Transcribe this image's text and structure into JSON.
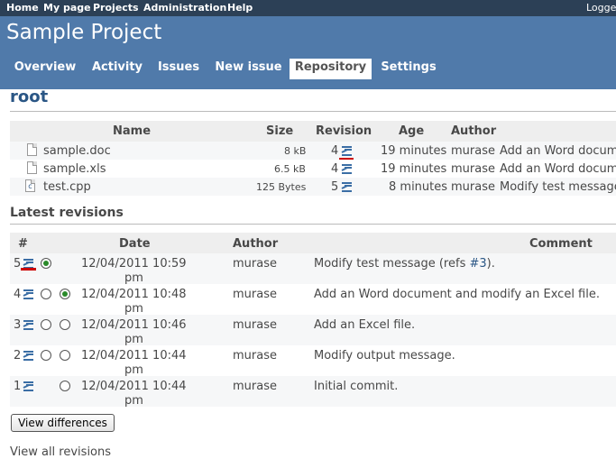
{
  "top_menu": {
    "home": "Home",
    "my_page": "My page",
    "projects": "Projects",
    "administration": "Administration",
    "help": "Help",
    "logged": "Logge"
  },
  "header": {
    "title": "Sample Project"
  },
  "main_menu": {
    "tabs": [
      {
        "label": "Overview"
      },
      {
        "label": "Activity"
      },
      {
        "label": "Issues"
      },
      {
        "label": "New issue"
      },
      {
        "label": "Repository",
        "selected": true
      },
      {
        "label": "Settings"
      }
    ]
  },
  "page_title": "root",
  "files": {
    "headers": {
      "name": "Name",
      "size": "Size",
      "revision": "Revision",
      "age": "Age",
      "author": "Author"
    },
    "rows": [
      {
        "name": "sample.doc",
        "icon": "document-icon",
        "size": "8 kB",
        "revision": "4",
        "age": "19 minutes",
        "author": "murase",
        "comment": "Add an Word docume"
      },
      {
        "name": "sample.xls",
        "icon": "document-icon",
        "size": "6.5 kB",
        "revision": "4",
        "age": "19 minutes",
        "author": "murase",
        "comment": "Add an Word docume"
      },
      {
        "name": "test.cpp",
        "icon": "cpp-file-icon",
        "size": "125 Bytes",
        "revision": "5",
        "age": "8 minutes",
        "author": "murase",
        "comment": "Modify test message"
      }
    ]
  },
  "latest_revisions": {
    "title": "Latest revisions",
    "headers": {
      "number": "#",
      "date": "Date",
      "author": "Author",
      "comment": "Comment"
    },
    "rows": [
      {
        "rev": "5",
        "date": "12/04/2011 10:59",
        "time_suffix": "pm",
        "author": "murase",
        "comment": "Modify test message (refs ",
        "ref": "#3",
        "comment_end": ")."
      },
      {
        "rev": "4",
        "date": "12/04/2011 10:48",
        "time_suffix": "pm",
        "author": "murase",
        "comment": "Add an Word document and modify an Excel file."
      },
      {
        "rev": "3",
        "date": "12/04/2011 10:46",
        "time_suffix": "pm",
        "author": "murase",
        "comment": "Add an Excel file."
      },
      {
        "rev": "2",
        "date": "12/04/2011 10:44",
        "time_suffix": "pm",
        "author": "murase",
        "comment": "Modify output message."
      },
      {
        "rev": "1",
        "date": "12/04/2011 10:44",
        "time_suffix": "pm",
        "author": "murase",
        "comment": "Initial commit."
      }
    ],
    "view_differences": "View differences",
    "view_all": "View all revisions"
  }
}
